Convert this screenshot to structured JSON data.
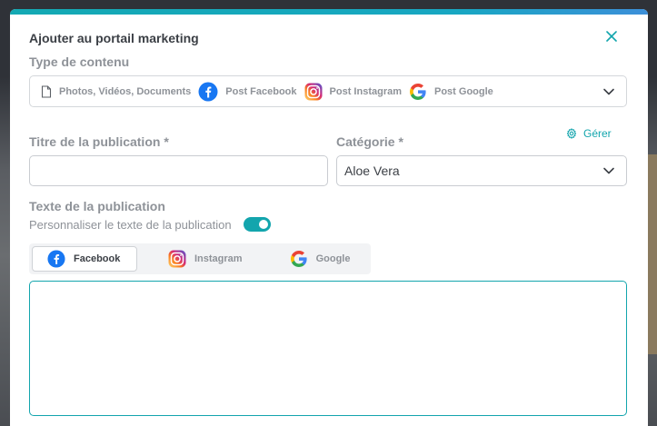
{
  "modal": {
    "title": "Ajouter au portail marketing",
    "close_icon": "close-icon"
  },
  "content_type": {
    "label": "Type de contenu",
    "options": [
      {
        "icon": "document-icon",
        "label": "Photos, Vidéos, Documents"
      },
      {
        "icon": "facebook-icon",
        "label": "Post Facebook"
      },
      {
        "icon": "instagram-icon",
        "label": "Post Instagram"
      },
      {
        "icon": "google-icon",
        "label": "Post Google"
      }
    ]
  },
  "manage": {
    "label": "Gérer",
    "icon": "gear-icon"
  },
  "publication_title": {
    "label": "Titre de la publication *",
    "value": ""
  },
  "category": {
    "label": "Catégorie *",
    "value": "Aloe Vera"
  },
  "publication_text": {
    "label": "Texte de la publication",
    "customize_label": "Personnaliser le texte de la publication",
    "customize_enabled": true,
    "tabs": [
      {
        "icon": "facebook-icon",
        "label": "Facebook",
        "active": true
      },
      {
        "icon": "instagram-icon",
        "label": "Instagram",
        "active": false
      },
      {
        "icon": "google-icon",
        "label": "Google",
        "active": false
      }
    ],
    "value": ""
  },
  "colors": {
    "accent": "#13a5ad",
    "title": "#3b3f45",
    "muted": "#8e9298",
    "facebook": "#1877f2"
  }
}
